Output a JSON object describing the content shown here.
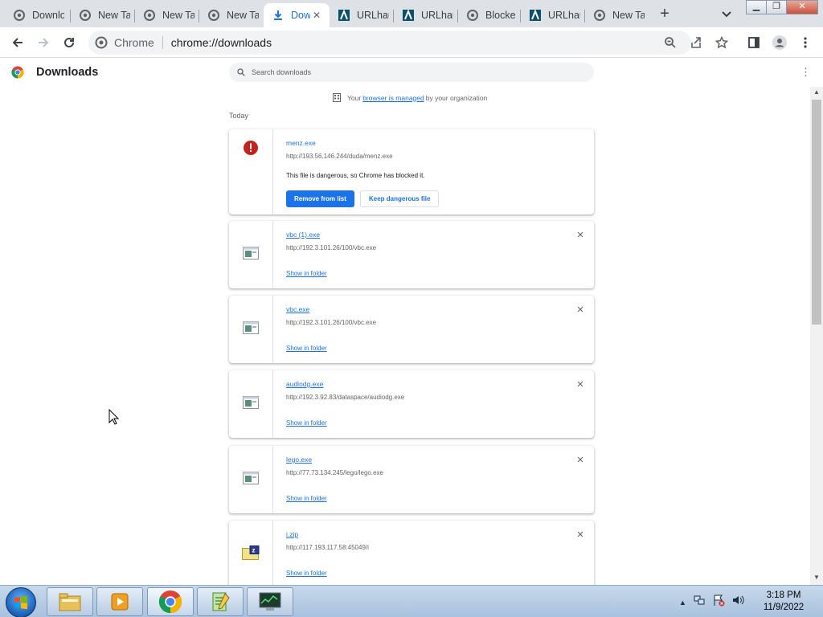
{
  "tabs": [
    {
      "label": "Downlo",
      "icon": "chrome-page-icon"
    },
    {
      "label": "New Ta",
      "icon": "chrome-page-icon"
    },
    {
      "label": "New Ta",
      "icon": "chrome-page-icon"
    },
    {
      "label": "New Ta",
      "icon": "chrome-page-icon"
    },
    {
      "label": "Dow",
      "icon": "download-icon",
      "active": true
    },
    {
      "label": "URLhau",
      "icon": "urlhaus-icon"
    },
    {
      "label": "URLhau",
      "icon": "urlhaus-icon"
    },
    {
      "label": "Blocke",
      "icon": "blocked-icon"
    },
    {
      "label": "URLhau",
      "icon": "urlhaus-icon"
    },
    {
      "label": "New Ta",
      "icon": "chrome-page-icon"
    }
  ],
  "omnibox": {
    "site": "Chrome",
    "url": "chrome://downloads"
  },
  "page": {
    "title": "Downloads",
    "search_placeholder": "Search downloads",
    "managed_prefix": "Your",
    "managed_link": "browser is managed",
    "managed_suffix": "by your organization",
    "section": "Today"
  },
  "downloads": [
    {
      "name": "menz.exe",
      "url": "http://193.56.146.244/duda/menz.exe",
      "description": "This file is dangerous, so Chrome has blocked it.",
      "primary_button": "Remove from list",
      "secondary_button": "Keep dangerous file",
      "icon": "danger-icon"
    },
    {
      "name": "vbc (1).exe",
      "url": "http://192.3.101.26/100/vbc.exe",
      "action": "Show in folder",
      "icon": "exe-file-icon"
    },
    {
      "name": "vbc.exe",
      "url": "http://192.3.101.26/100/vbc.exe",
      "action": "Show in folder",
      "icon": "exe-file-icon"
    },
    {
      "name": "audiodg.exe",
      "url": "http://192.3.92.83/dataspace/audiodg.exe",
      "action": "Show in folder",
      "icon": "exe-file-icon"
    },
    {
      "name": "lego.exe",
      "url": "http://77.73.134.245/lego/lego.exe",
      "action": "Show in folder",
      "icon": "exe-file-icon"
    },
    {
      "name": "i.zip",
      "url": "http://117.193.117.58:45049/i",
      "action": "Show in folder",
      "icon": "zip-file-icon"
    }
  ],
  "taskbar": {
    "apps": [
      "explorer",
      "media-player",
      "chrome",
      "notepad",
      "task-manager"
    ],
    "time": "3:18 PM",
    "date": "11/9/2022"
  }
}
